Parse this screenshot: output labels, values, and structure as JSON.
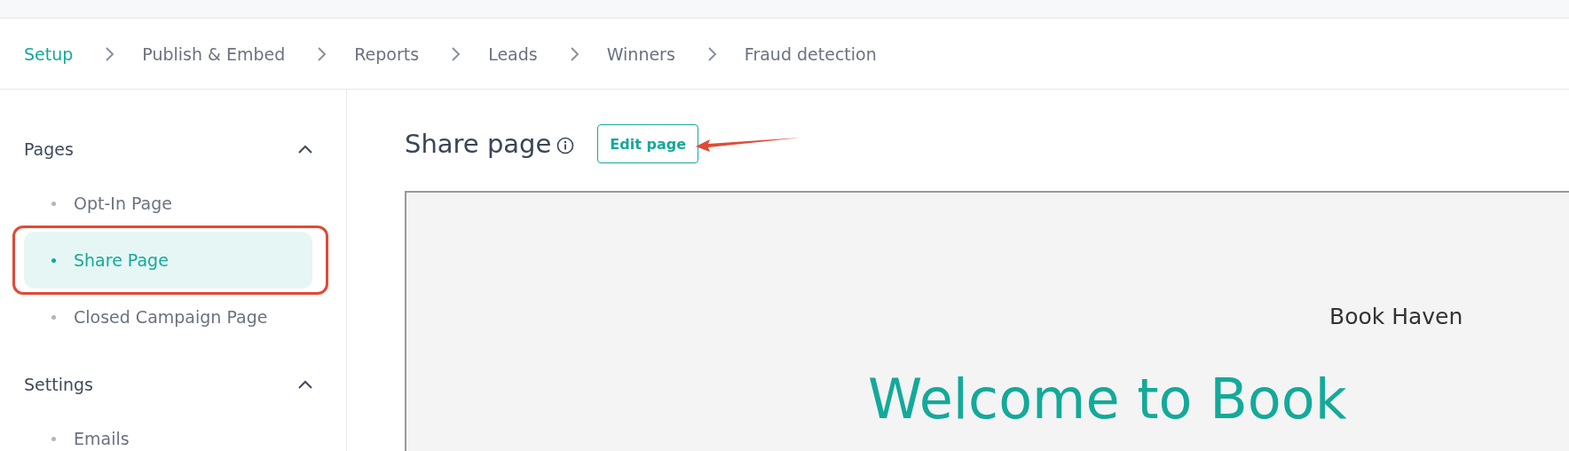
{
  "breadcrumb": [
    {
      "label": "Setup",
      "selected": true
    },
    {
      "label": "Publish & Embed",
      "selected": false
    },
    {
      "label": "Reports",
      "selected": false
    },
    {
      "label": "Leads",
      "selected": false
    },
    {
      "label": "Winners",
      "selected": false
    },
    {
      "label": "Fraud detection",
      "selected": false
    }
  ],
  "sidebar": {
    "sections": [
      {
        "title": "Pages",
        "expanded": true,
        "items": [
          {
            "label": "Opt-In Page",
            "selected": false
          },
          {
            "label": "Share Page",
            "selected": true
          },
          {
            "label": "Closed Campaign Page",
            "selected": false
          }
        ]
      },
      {
        "title": "Settings",
        "expanded": true,
        "items": [
          {
            "label": "Emails",
            "selected": false
          }
        ]
      }
    ]
  },
  "main": {
    "title": "Share page",
    "edit_button": "Edit page",
    "preview": {
      "brand": "Book Haven",
      "headline": "Welcome to Book"
    }
  }
}
